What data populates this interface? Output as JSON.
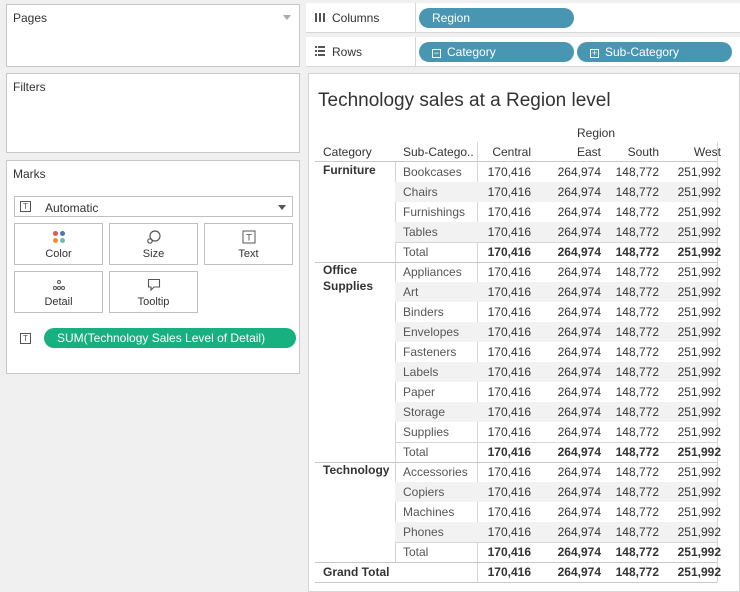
{
  "panels": {
    "pages_title": "Pages",
    "filters_title": "Filters",
    "marks_title": "Marks"
  },
  "marks": {
    "type": "Automatic",
    "buttons": [
      "Color",
      "Size",
      "Text",
      "Detail",
      "Tooltip"
    ],
    "field_pill": "SUM(Technology Sales Level of Detail)"
  },
  "shelves": {
    "columns_label": "Columns",
    "rows_label": "Rows",
    "columns_pills": [
      "Region"
    ],
    "rows_pills": [
      "Category",
      "Sub-Category"
    ]
  },
  "view": {
    "title": "Technology sales at a Region level",
    "region_header": "Region",
    "row_headers": [
      "Category",
      "Sub-Catego.."
    ],
    "columns": [
      "Central",
      "East",
      "South",
      "West"
    ],
    "groups": [
      {
        "category": "Furniture",
        "rows": [
          {
            "sub": "Bookcases",
            "values": [
              "170,416",
              "264,974",
              "148,772",
              "251,992"
            ]
          },
          {
            "sub": "Chairs",
            "values": [
              "170,416",
              "264,974",
              "148,772",
              "251,992"
            ]
          },
          {
            "sub": "Furnishings",
            "values": [
              "170,416",
              "264,974",
              "148,772",
              "251,992"
            ]
          },
          {
            "sub": "Tables",
            "values": [
              "170,416",
              "264,974",
              "148,772",
              "251,992"
            ]
          },
          {
            "sub": "Total",
            "values": [
              "170,416",
              "264,974",
              "148,772",
              "251,992"
            ],
            "total": true
          }
        ]
      },
      {
        "category": "Office Supplies",
        "rows": [
          {
            "sub": "Appliances",
            "values": [
              "170,416",
              "264,974",
              "148,772",
              "251,992"
            ]
          },
          {
            "sub": "Art",
            "values": [
              "170,416",
              "264,974",
              "148,772",
              "251,992"
            ]
          },
          {
            "sub": "Binders",
            "values": [
              "170,416",
              "264,974",
              "148,772",
              "251,992"
            ]
          },
          {
            "sub": "Envelopes",
            "values": [
              "170,416",
              "264,974",
              "148,772",
              "251,992"
            ]
          },
          {
            "sub": "Fasteners",
            "values": [
              "170,416",
              "264,974",
              "148,772",
              "251,992"
            ]
          },
          {
            "sub": "Labels",
            "values": [
              "170,416",
              "264,974",
              "148,772",
              "251,992"
            ]
          },
          {
            "sub": "Paper",
            "values": [
              "170,416",
              "264,974",
              "148,772",
              "251,992"
            ]
          },
          {
            "sub": "Storage",
            "values": [
              "170,416",
              "264,974",
              "148,772",
              "251,992"
            ]
          },
          {
            "sub": "Supplies",
            "values": [
              "170,416",
              "264,974",
              "148,772",
              "251,992"
            ]
          },
          {
            "sub": "Total",
            "values": [
              "170,416",
              "264,974",
              "148,772",
              "251,992"
            ],
            "total": true
          }
        ]
      },
      {
        "category": "Technology",
        "rows": [
          {
            "sub": "Accessories",
            "values": [
              "170,416",
              "264,974",
              "148,772",
              "251,992"
            ]
          },
          {
            "sub": "Copiers",
            "values": [
              "170,416",
              "264,974",
              "148,772",
              "251,992"
            ]
          },
          {
            "sub": "Machines",
            "values": [
              "170,416",
              "264,974",
              "148,772",
              "251,992"
            ]
          },
          {
            "sub": "Phones",
            "values": [
              "170,416",
              "264,974",
              "148,772",
              "251,992"
            ]
          },
          {
            "sub": "Total",
            "values": [
              "170,416",
              "264,974",
              "148,772",
              "251,992"
            ],
            "total": true
          }
        ]
      }
    ],
    "grand_total": {
      "label": "Grand Total",
      "values": [
        "170,416",
        "264,974",
        "148,772",
        "251,992"
      ]
    }
  },
  "colors": {
    "blue_pill": "#4996b2",
    "green_pill": "#17b07e",
    "band": "#f2f2f2"
  }
}
